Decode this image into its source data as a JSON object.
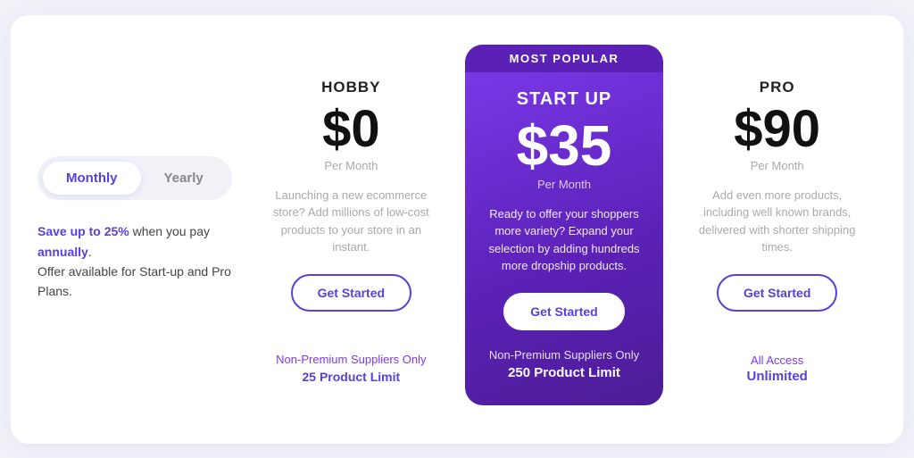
{
  "toggle": {
    "monthly_label": "Monthly",
    "yearly_label": "Yearly",
    "active": "monthly"
  },
  "savings": {
    "line1_prefix": "Save up to ",
    "line1_percent": "25%",
    "line1_middle": " when you pay ",
    "line1_annually": "annually",
    "line1_end": ".",
    "line2": "Offer available for Start-up and Pro Plans."
  },
  "popular_badge": "MOST POPULAR",
  "plans": [
    {
      "id": "hobby",
      "name": "HOBBY",
      "price": "$0",
      "per_month": "Per Month",
      "description": "Launching a new ecommerce store? Add millions of low-cost products to your store in an instant.",
      "cta": "Get Started",
      "supplier_label": "Non-Premium Suppliers Only",
      "limit_label": "25 Product Limit",
      "popular": false
    },
    {
      "id": "startup",
      "name": "START UP",
      "price": "$35",
      "per_month": "Per Month",
      "description": "Ready to offer your shoppers more variety? Expand your selection by adding hundreds more dropship products.",
      "cta": "Get Started",
      "supplier_label": "Non-Premium Suppliers Only",
      "limit_label": "250 Product Limit",
      "popular": true
    },
    {
      "id": "pro",
      "name": "PRO",
      "price": "$90",
      "per_month": "Per Month",
      "description": "Add even more products, including well known brands, delivered with shorter shipping times.",
      "cta": "Get Started",
      "access_label": "All Access",
      "limit_label": "Unlimited",
      "popular": false
    }
  ]
}
